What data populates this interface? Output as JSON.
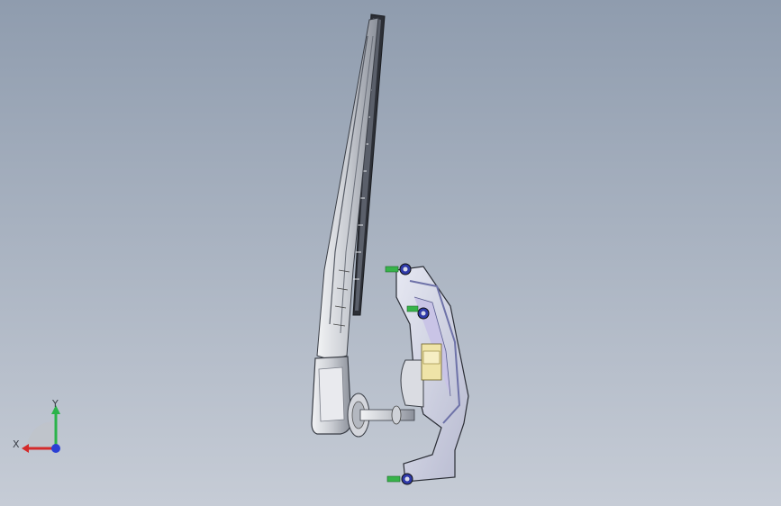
{
  "viewport": {
    "background_top": "#8f9cae",
    "background_bottom": "#c6ccd6"
  },
  "model": {
    "icon": "wiper-assembly-icon"
  },
  "triad": {
    "x_label": "X",
    "y_label": "Y",
    "x_color": "#d42a2a",
    "y_color": "#2bb34a",
    "z_color": "#2a3fd4"
  }
}
